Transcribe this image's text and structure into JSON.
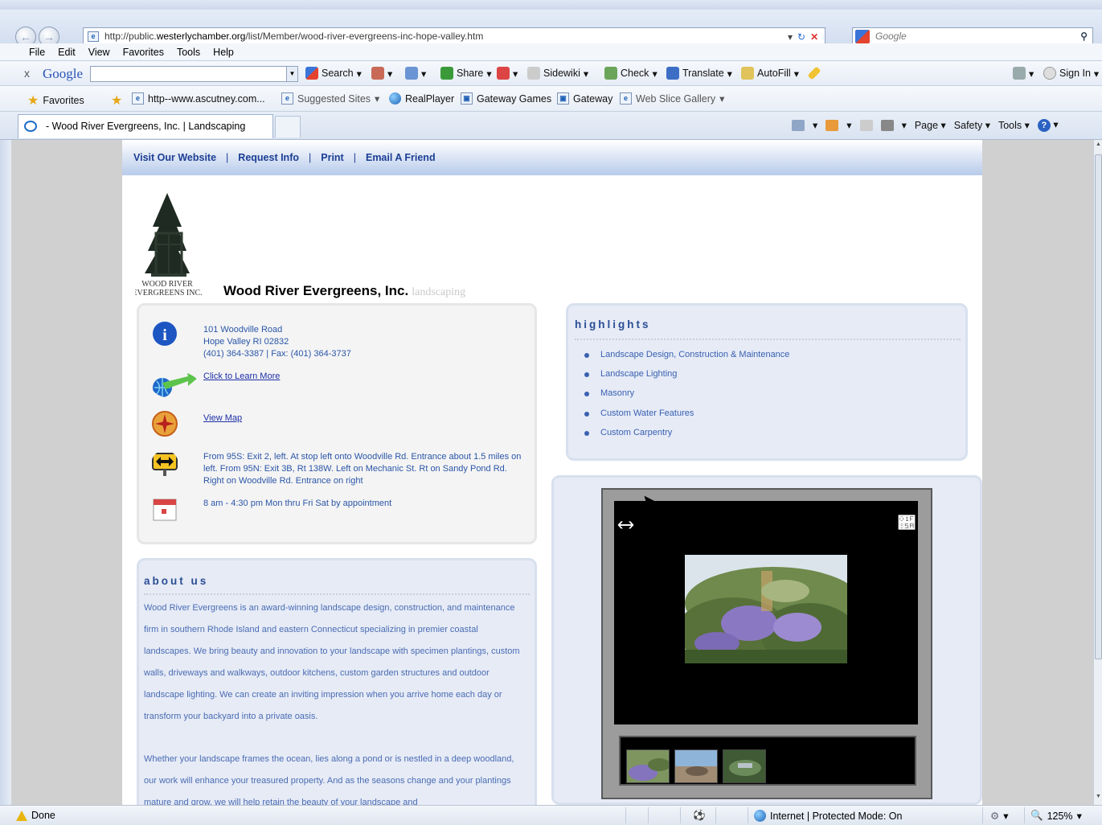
{
  "browser": {
    "url_prefix": "http://public.",
    "url_domain": "westerlychamber.org",
    "url_path": "/list/Member/wood-river-evergreens-inc-hope-valley.htm",
    "search_placeholder": "Google",
    "menu": [
      "File",
      "Edit",
      "View",
      "Favorites",
      "Tools",
      "Help"
    ],
    "google_toolbar": {
      "logo": "Google",
      "search": "Search",
      "share": "Share",
      "sidewiki": "Sidewiki",
      "check": "Check",
      "translate": "Translate",
      "autofill": "AutoFill",
      "sign_in": "Sign In"
    },
    "favorites": {
      "favorites_label": "Favorites",
      "items": [
        "http--www.ascutney.com...",
        "Suggested Sites",
        "RealPlayer",
        "Gateway Games",
        "Gateway",
        "Web Slice Gallery"
      ]
    },
    "tab_title": "- Wood River Evergreens, Inc. | Landscaping",
    "commands": {
      "page": "Page",
      "safety": "Safety",
      "tools": "Tools"
    },
    "status": {
      "left": "Done",
      "zone": "Internet | Protected Mode: On",
      "zoom": "125%"
    }
  },
  "page": {
    "links": [
      "Visit Our Website",
      "Request Info",
      "Print",
      "Email A Friend"
    ],
    "logo_text": [
      "WOOD RIVER",
      "EVERGREENS INC."
    ],
    "business_name": "Wood River Evergreens, Inc.",
    "business_category": "landscaping",
    "contact": {
      "address1": "101 Woodville Road",
      "address2": "Hope Valley RI 02832",
      "phone": "(401) 364-3387 | Fax: (401) 364-3737",
      "learn_more": "Click to Learn More",
      "map": "View Map",
      "directions": "From 95S: Exit 2, left. At stop left onto Woodville Rd. Entrance about 1.5 miles on left. From 95N: Exit 3B, Rt 138W. Left on Mechanic St. Rt on Sandy Pond Rd. Right on Woodville Rd. Entrance on right",
      "hours": "8 am - 4:30 pm Mon thru Fri Sat by appointment"
    },
    "about": {
      "title": "about us",
      "p1": "Wood River Evergreens is an award-winning landscape design, construction, and maintenance firm in southern Rhode Island and eastern Connecticut specializing in premier coastal landscapes. We bring beauty and innovation to your landscape with specimen plantings, custom walls, driveways and walkways, outdoor kitchens, custom garden structures and outdoor landscape lighting. We can create an inviting impression when you arrive home each day or transform your backyard into a private oasis.",
      "p2": "Whether your landscape frames the ocean, lies along a pond or is nestled in a deep woodland, our work will enhance your treasured property. And as the seasons change and your plantings mature and grow, we will help retain the beauty of your landscape and"
    },
    "highlights": {
      "title": "highlights",
      "items": [
        "Landscape Design, Construction & Maintenance",
        "Landscape Lighting",
        "Masonry",
        "Custom Water Features",
        "Custom Carpentry"
      ]
    }
  }
}
